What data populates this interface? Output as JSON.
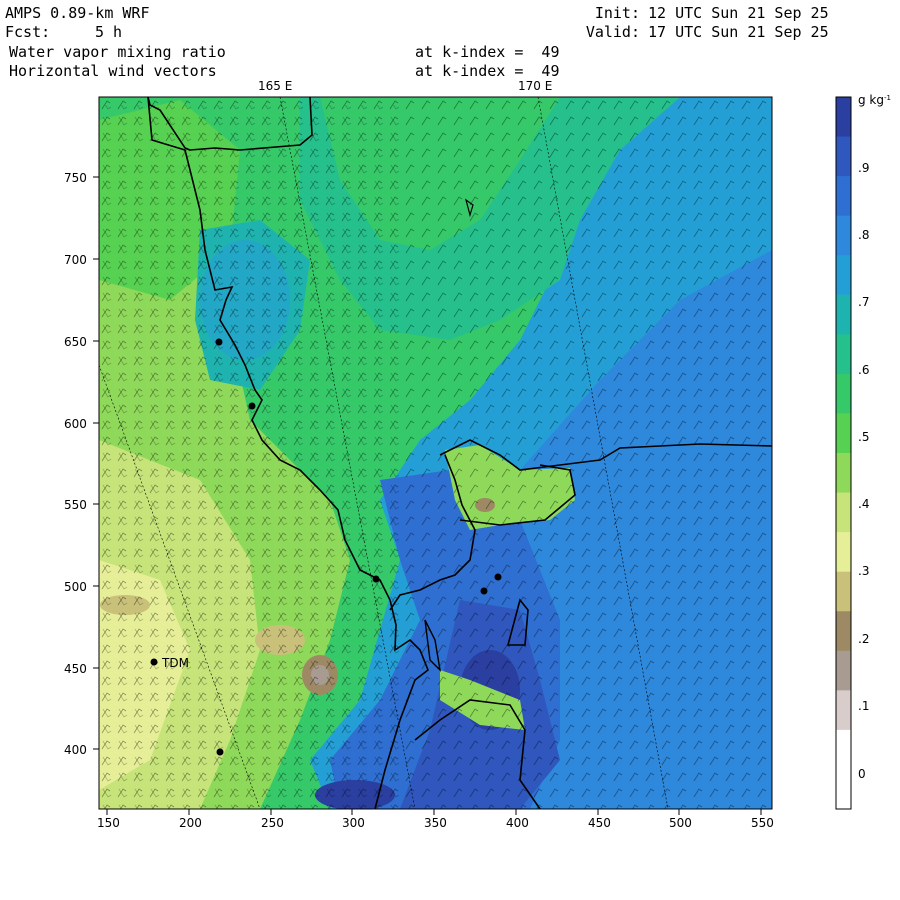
{
  "header": {
    "model": "AMPS 0.89-km WRF",
    "fcst_label": "Fcst:",
    "fcst_value": "5 h",
    "init_label": "Init:",
    "init_value": "12 UTC Sun 21 Sep 25",
    "valid_label": "Valid:",
    "valid_value": "17 UTC Sun 21 Sep 25",
    "field1": "Water vapor mixing ratio",
    "field2": "Horizontal wind vectors",
    "level1": "at k-index =  49",
    "level2": "at k-index =  49"
  },
  "map": {
    "longitude_labels": [
      "165 E",
      "170 E"
    ],
    "x_ticks": [
      "150",
      "200",
      "250",
      "300",
      "350",
      "400",
      "450",
      "500",
      "550"
    ],
    "y_ticks": [
      "750",
      "700",
      "650",
      "600",
      "550",
      "500",
      "450",
      "400"
    ],
    "station_label": "TDM",
    "x_range": [
      145,
      555
    ],
    "y_range": [
      365,
      795
    ]
  },
  "colorbar": {
    "unit": "g kg",
    "unit_sup": "-1",
    "labels": [
      ".9",
      ".8",
      ".7",
      ".6",
      ".5",
      ".4",
      ".3",
      ".2",
      ".1",
      "0"
    ],
    "colors": [
      "#2a3fa0",
      "#2f57bd",
      "#2e6fd1",
      "#2e88dc",
      "#249fd6",
      "#1fb3b0",
      "#25c08c",
      "#36c96a",
      "#57d152",
      "#8fd95a",
      "#c6e47a",
      "#e6ef98",
      "#c9c07a",
      "#9d8a64",
      "#a89b92",
      "#d9cdcb",
      "#ffffff",
      "#ffffff"
    ]
  }
}
